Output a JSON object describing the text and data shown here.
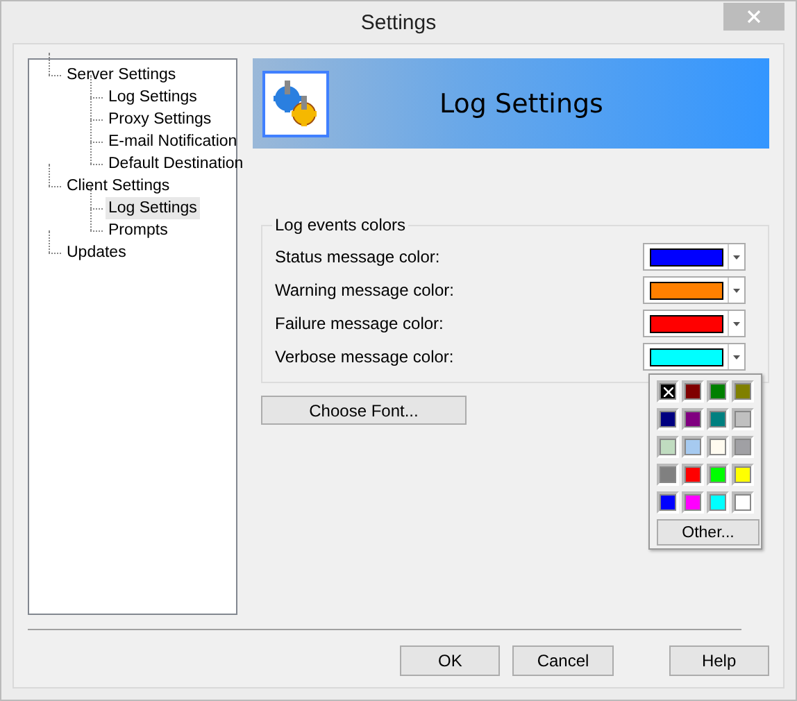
{
  "window": {
    "title": "Settings"
  },
  "tree": [
    {
      "label": "Server Settings",
      "selected": false,
      "children": [
        {
          "label": "Log Settings",
          "selected": false
        },
        {
          "label": "Proxy Settings",
          "selected": false
        },
        {
          "label": "E-mail Notification",
          "selected": false
        },
        {
          "label": "Default Destination",
          "selected": false
        }
      ]
    },
    {
      "label": "Client Settings",
      "selected": false,
      "children": [
        {
          "label": "Log Settings",
          "selected": true
        },
        {
          "label": "Prompts",
          "selected": false
        }
      ]
    },
    {
      "label": "Updates",
      "selected": false
    }
  ],
  "header": {
    "title": "Log Settings"
  },
  "group": {
    "title": "Log events colors",
    "rows": [
      {
        "label": "Status message color:",
        "color": "#0000ff"
      },
      {
        "label": "Warning message color:",
        "color": "#ff8000"
      },
      {
        "label": "Failure message color:",
        "color": "#ff0000"
      },
      {
        "label": "Verbose message color:",
        "color": "#00ffff"
      }
    ]
  },
  "choose_font_button": "Choose Font...",
  "palette": {
    "swatches": [
      {
        "kind": "clear",
        "color": "#000000"
      },
      {
        "kind": "plain",
        "color": "#800000"
      },
      {
        "kind": "plain",
        "color": "#008000"
      },
      {
        "kind": "plain",
        "color": "#808000"
      },
      {
        "kind": "plain",
        "color": "#000080"
      },
      {
        "kind": "plain",
        "color": "#800080"
      },
      {
        "kind": "plain",
        "color": "#008080"
      },
      {
        "kind": "plain",
        "color": "#c0c0c0"
      },
      {
        "kind": "plain",
        "color": "#c0dcc0"
      },
      {
        "kind": "plain",
        "color": "#a6caf0"
      },
      {
        "kind": "plain",
        "color": "#fffbf0"
      },
      {
        "kind": "plain",
        "color": "#a0a0a4"
      },
      {
        "kind": "plain",
        "color": "#808080"
      },
      {
        "kind": "plain",
        "color": "#ff0000"
      },
      {
        "kind": "plain",
        "color": "#00ff00"
      },
      {
        "kind": "plain",
        "color": "#ffff00"
      },
      {
        "kind": "plain",
        "color": "#0000ff"
      },
      {
        "kind": "plain",
        "color": "#ff00ff"
      },
      {
        "kind": "plain",
        "color": "#00ffff"
      },
      {
        "kind": "plain",
        "color": "#ffffff"
      }
    ],
    "other_button": "Other..."
  },
  "buttons": [
    "OK",
    "Cancel",
    "Help"
  ]
}
